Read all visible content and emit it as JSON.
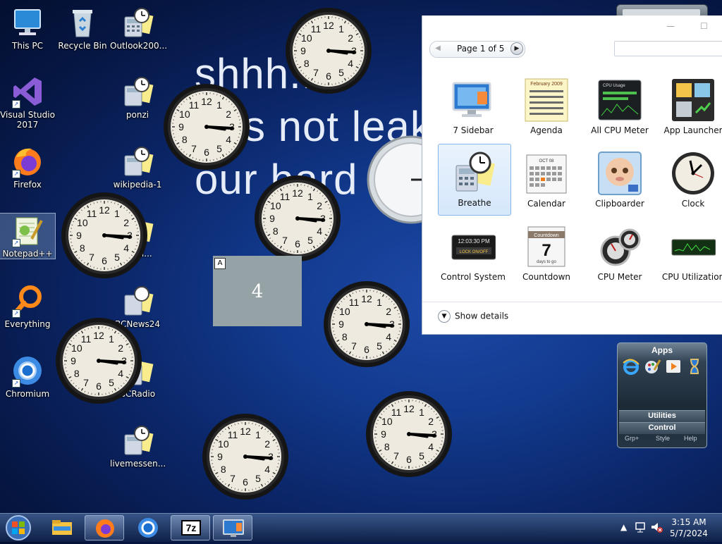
{
  "wallpaper": {
    "line1": "shhh..",
    "line2": "s not leak",
    "line3": "our hard"
  },
  "desktop_icons": [
    {
      "label": "This PC"
    },
    {
      "label": "Recycle Bin"
    },
    {
      "label": "Outlook200..."
    },
    {
      "label": "Visual Studio 2017"
    },
    {
      "label": "ponzi"
    },
    {
      "label": "Firefox"
    },
    {
      "label": "wikipedia-1"
    },
    {
      "label": "Notepad++"
    },
    {
      "label": "...bui..."
    },
    {
      "label": "Everything"
    },
    {
      "label": "BCNews24"
    },
    {
      "label": "Chromium"
    },
    {
      "label": "BCRadio"
    },
    {
      "label": "livemessen..."
    }
  ],
  "gallery": {
    "pager": "Page 1 of 5",
    "items": [
      {
        "label": "7 Sidebar"
      },
      {
        "label": "Agenda"
      },
      {
        "label": "All CPU Meter"
      },
      {
        "label": "App Launcher"
      },
      {
        "label": "Breathe"
      },
      {
        "label": "Calendar"
      },
      {
        "label": "Clipboarder"
      },
      {
        "label": "Clock"
      },
      {
        "label": "Control System"
      },
      {
        "label": "Countdown"
      },
      {
        "label": "CPU Meter"
      },
      {
        "label": "CPU Utilization"
      }
    ],
    "agenda_date": "February 2009",
    "countdown_head": "Countdown",
    "countdown_num": "7",
    "countdown_sub": "days to go",
    "control_time": "12:03:30 PM",
    "control_lock": "LOCK ON/OFF",
    "cpu_usage": "CPU Usage",
    "calendar_month": "OCT 08",
    "show_details": "Show details"
  },
  "box4": {
    "letter": "A",
    "number": "4"
  },
  "dock": {
    "title": "Apps",
    "utilities": "Utilities",
    "control": "Control",
    "grp": "Grp+",
    "style": "Style",
    "help": "Help"
  },
  "taskbar": {
    "time": "3:15 AM",
    "date": "5/7/2024",
    "sevenzip": "7z"
  },
  "colors": {
    "accent": "#1d49a6",
    "taskbar": "#0e2046"
  }
}
